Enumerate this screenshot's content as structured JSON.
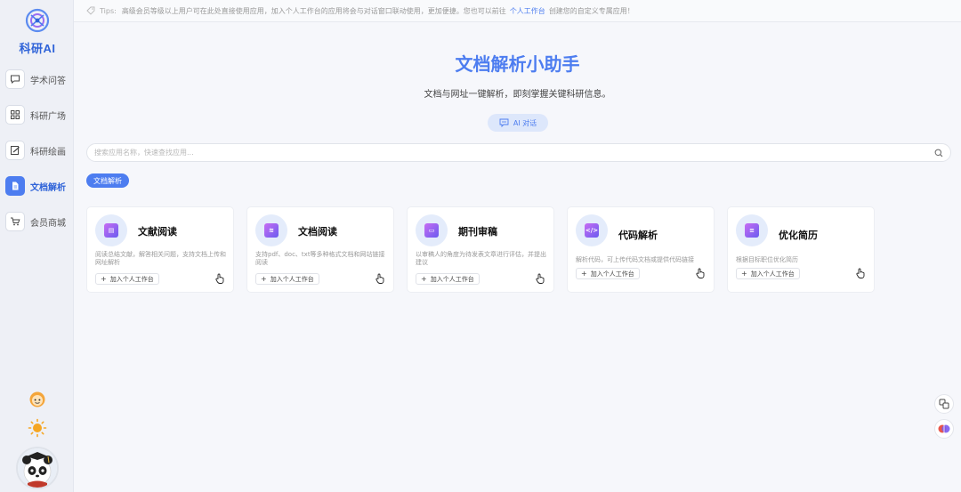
{
  "app": {
    "logo_text": "科研AI"
  },
  "nav": [
    {
      "key": "qa",
      "label": "学术问答",
      "icon": "chat-icon"
    },
    {
      "key": "square",
      "label": "科研广场",
      "icon": "grid-icon"
    },
    {
      "key": "draw",
      "label": "科研绘画",
      "icon": "paint-icon"
    },
    {
      "key": "parse",
      "label": "文档解析",
      "icon": "document-icon",
      "active": true
    },
    {
      "key": "shop",
      "label": "会员商城",
      "icon": "cart-icon"
    }
  ],
  "tips": {
    "prefix": "Tips:",
    "text": "高级会员等级以上用户可在此处直接使用应用，加入个人工作台的应用将会与对话窗口联动使用，更加便捷。您也可以前往",
    "link": "个人工作台",
    "suffix": "创建您的自定义专属应用！"
  },
  "hero": {
    "title": "文档解析小助手",
    "subtitle": "文档与网址一键解析，即刻掌握关键科研信息。",
    "ai_button": "AI 对话"
  },
  "search": {
    "placeholder": "搜索应用名称，快速查找应用..."
  },
  "category_tag": "文档解析",
  "cards": [
    {
      "title": "文献阅读",
      "desc": "阅读总结文献，解答相关问题，支持文档上传和网址解析",
      "add": "加入个人工作台",
      "icon": "book-icon"
    },
    {
      "title": "文档阅读",
      "desc": "支持pdf、doc、txt等多种格式文档和网站链接阅读",
      "add": "加入个人工作台",
      "icon": "layers-icon"
    },
    {
      "title": "期刊审稿",
      "desc": "以审稿人的角度为待发表文章进行评估，并提出建议",
      "add": "加入个人工作台",
      "icon": "folder-icon"
    },
    {
      "title": "代码解析",
      "desc": "解析代码，可上传代码文档或提供代码链接",
      "add": "加入个人工作台",
      "icon": "code-icon"
    },
    {
      "title": "优化简历",
      "desc": "根据目标职位优化简历",
      "add": "加入个人工作台",
      "icon": "resume-icon"
    }
  ],
  "colors": {
    "accent": "#4d7df0",
    "sidebar_bg": "#eef0f6",
    "page_bg": "#f6f7fb"
  }
}
